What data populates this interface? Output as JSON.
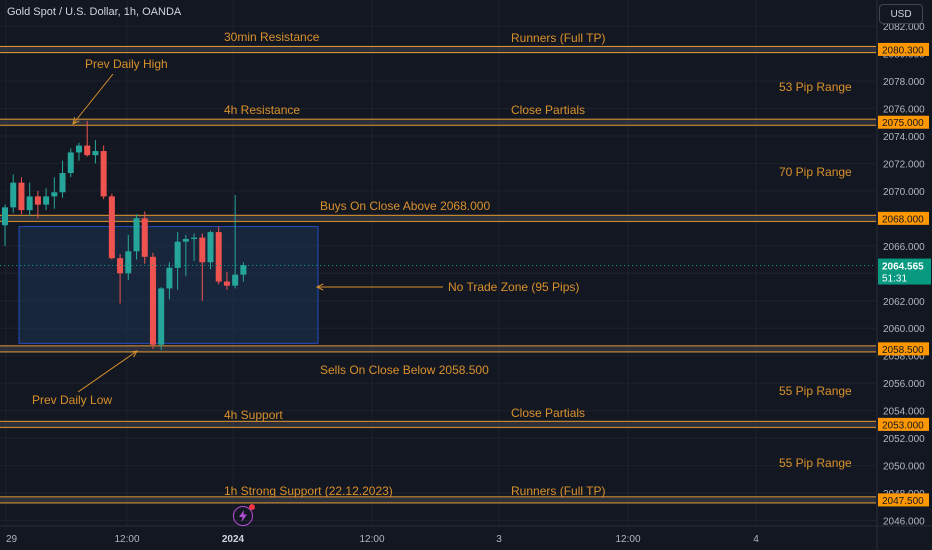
{
  "header": {
    "symbol_title": "Gold Spot / U.S. Dollar, 1h, OANDA",
    "currency": "USD"
  },
  "colors": {
    "background": "#131722",
    "grid": "#1e222d",
    "text": "#d1d4dc",
    "annotation": "#d9912b",
    "level_line": "#d9912b",
    "level_band": "#434651",
    "up_candle": "#26a69a",
    "down_candle": "#ef5350",
    "zone_fill": "#1e3350",
    "zone_border": "#2962ff",
    "price_label_bg": "#ff9800",
    "last_price_bg": "#089981"
  },
  "chart_data": {
    "type": "candlestick",
    "price_axis": {
      "ticks": [
        "2082.000",
        "2080.000",
        "2078.000",
        "2076.000",
        "2074.000",
        "2072.000",
        "2070.000",
        "2068.000",
        "2066.000",
        "2064.000",
        "2062.000",
        "2060.000",
        "2058.000",
        "2056.000",
        "2054.000",
        "2052.000",
        "2050.000",
        "2048.000",
        "2046.000"
      ],
      "range": [
        2045.6,
        2083.9
      ]
    },
    "time_axis": {
      "ticks": [
        "29",
        "12:00",
        "2024",
        "12:00",
        "3",
        "12:00",
        "4"
      ]
    },
    "last_price": {
      "value": "2064.565",
      "countdown": "51:31",
      "price": 2064.565
    },
    "levels": [
      {
        "price": 2080.3,
        "label": "2080.300"
      },
      {
        "price": 2075.0,
        "label": "2075.000"
      },
      {
        "price": 2068.0,
        "label": "2068.000"
      },
      {
        "price": 2058.5,
        "label": "2058.500"
      },
      {
        "price": 2053.0,
        "label": "2053.000"
      },
      {
        "price": 2047.5,
        "label": "2047.500"
      }
    ],
    "zone": {
      "label": "No Trade Zone (95 Pips)",
      "top": 2067.4,
      "bottom": 2058.9
    },
    "annotations": {
      "resistance_30min": "30min Resistance",
      "runners_top": "Runners (Full TP)",
      "prev_daily_high": "Prev Daily High",
      "range_53": "53 Pip Range",
      "resistance_4h": "4h Resistance",
      "close_partials_top": "Close Partials",
      "range_70": "70 Pip Range",
      "buys_above": "Buys On Close Above 2068.000",
      "no_trade_zone": "No Trade Zone (95 Pips)",
      "sells_below": "Sells On Close Below 2058.500",
      "prev_daily_low": "Prev Daily Low",
      "range_55_a": "55 Pip Range",
      "support_4h": "4h Support",
      "close_partials_bottom": "Close Partials",
      "range_55_b": "55 Pip Range",
      "support_1h": "1h Strong Support (22.12.2023)",
      "runners_bottom": "Runners (Full TP)"
    },
    "candles": [
      {
        "o": 2067.5,
        "h": 2069.0,
        "l": 2066.0,
        "c": 2068.8
      },
      {
        "o": 2068.8,
        "h": 2071.2,
        "l": 2068.4,
        "c": 2070.6
      },
      {
        "o": 2070.6,
        "h": 2071.0,
        "l": 2068.3,
        "c": 2068.6
      },
      {
        "o": 2068.6,
        "h": 2070.6,
        "l": 2068.2,
        "c": 2069.6
      },
      {
        "o": 2069.6,
        "h": 2070.0,
        "l": 2068.0,
        "c": 2069.0
      },
      {
        "o": 2069.0,
        "h": 2070.2,
        "l": 2068.6,
        "c": 2069.6
      },
      {
        "o": 2069.6,
        "h": 2071.0,
        "l": 2068.7,
        "c": 2069.9
      },
      {
        "o": 2069.9,
        "h": 2072.2,
        "l": 2069.5,
        "c": 2071.3
      },
      {
        "o": 2071.3,
        "h": 2073.1,
        "l": 2071.0,
        "c": 2072.8
      },
      {
        "o": 2072.8,
        "h": 2073.5,
        "l": 2072.2,
        "c": 2073.3
      },
      {
        "o": 2073.3,
        "h": 2075.1,
        "l": 2072.5,
        "c": 2072.6
      },
      {
        "o": 2072.6,
        "h": 2073.7,
        "l": 2072.0,
        "c": 2072.9
      },
      {
        "o": 2072.9,
        "h": 2073.3,
        "l": 2069.4,
        "c": 2069.6
      },
      {
        "o": 2069.6,
        "h": 2069.8,
        "l": 2065.0,
        "c": 2065.1
      },
      {
        "o": 2065.1,
        "h": 2065.4,
        "l": 2061.8,
        "c": 2064.0
      },
      {
        "o": 2064.0,
        "h": 2066.8,
        "l": 2063.5,
        "c": 2065.6
      },
      {
        "o": 2065.6,
        "h": 2068.3,
        "l": 2065.0,
        "c": 2068.0
      },
      {
        "o": 2068.0,
        "h": 2068.5,
        "l": 2064.7,
        "c": 2065.2
      },
      {
        "o": 2065.2,
        "h": 2065.5,
        "l": 2058.5,
        "c": 2058.8
      },
      {
        "o": 2058.8,
        "h": 2063.0,
        "l": 2058.4,
        "c": 2062.9
      },
      {
        "o": 2062.9,
        "h": 2064.8,
        "l": 2062.1,
        "c": 2064.4
      },
      {
        "o": 2064.4,
        "h": 2067.0,
        "l": 2062.8,
        "c": 2066.3
      },
      {
        "o": 2066.3,
        "h": 2066.8,
        "l": 2063.8,
        "c": 2066.5
      },
      {
        "o": 2066.5,
        "h": 2066.9,
        "l": 2064.9,
        "c": 2066.6
      },
      {
        "o": 2066.6,
        "h": 2066.9,
        "l": 2062.0,
        "c": 2064.8
      },
      {
        "o": 2064.8,
        "h": 2067.1,
        "l": 2064.3,
        "c": 2067.0
      },
      {
        "o": 2067.0,
        "h": 2067.4,
        "l": 2063.2,
        "c": 2063.4
      },
      {
        "o": 2063.4,
        "h": 2064.1,
        "l": 2062.8,
        "c": 2063.1
      },
      {
        "o": 2063.1,
        "h": 2069.7,
        "l": 2062.9,
        "c": 2063.9
      },
      {
        "o": 2063.9,
        "h": 2064.8,
        "l": 2063.4,
        "c": 2064.6
      }
    ]
  }
}
